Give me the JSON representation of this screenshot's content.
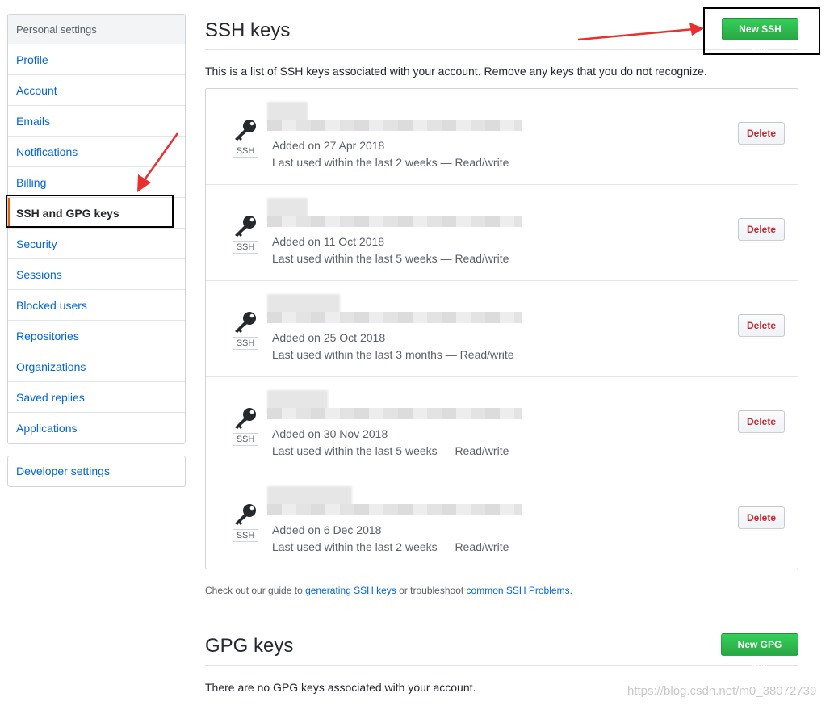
{
  "sidebar": {
    "heading": "Personal settings",
    "items": [
      {
        "label": "Profile"
      },
      {
        "label": "Account"
      },
      {
        "label": "Emails"
      },
      {
        "label": "Notifications"
      },
      {
        "label": "Billing"
      },
      {
        "label": "SSH and GPG keys"
      },
      {
        "label": "Security"
      },
      {
        "label": "Sessions"
      },
      {
        "label": "Blocked users"
      },
      {
        "label": "Repositories"
      },
      {
        "label": "Organizations"
      },
      {
        "label": "Saved replies"
      },
      {
        "label": "Applications"
      }
    ],
    "selected_index": 5,
    "developer_settings": "Developer settings"
  },
  "ssh": {
    "title": "SSH keys",
    "new_button": "New SSH key",
    "intro": "This is a list of SSH keys associated with your account. Remove any keys that you do not recognize.",
    "keys": [
      {
        "badge": "SSH",
        "added": "Added on 27 Apr 2018",
        "last_used": "Last used within the last 2 weeks — Read/write",
        "delete": "Delete"
      },
      {
        "badge": "SSH",
        "added": "Added on 11 Oct 2018",
        "last_used": "Last used within the last 5 weeks — Read/write",
        "delete": "Delete"
      },
      {
        "badge": "SSH",
        "added": "Added on 25 Oct 2018",
        "last_used": "Last used within the last 3 months — Read/write",
        "delete": "Delete"
      },
      {
        "badge": "SSH",
        "added": "Added on 30 Nov 2018",
        "last_used": "Last used within the last 5 weeks — Read/write",
        "delete": "Delete"
      },
      {
        "badge": "SSH",
        "added": "Added on 6 Dec 2018",
        "last_used": "Last used within the last 2 weeks — Read/write",
        "delete": "Delete"
      }
    ],
    "help_prefix": "Check out our guide to ",
    "help_link1": "generating SSH keys",
    "help_middle": " or troubleshoot ",
    "help_link2": "common SSH Problems",
    "help_suffix": "."
  },
  "gpg": {
    "title": "GPG keys",
    "new_button": "New GPG key",
    "empty": "There are no GPG keys associated with your account."
  },
  "watermark": "https://blog.csdn.net/m0_38072739",
  "colors": {
    "link": "#0366d6",
    "primary": "#28a745",
    "danger": "#cb2431",
    "annotation_arrow": "#e8302f"
  }
}
